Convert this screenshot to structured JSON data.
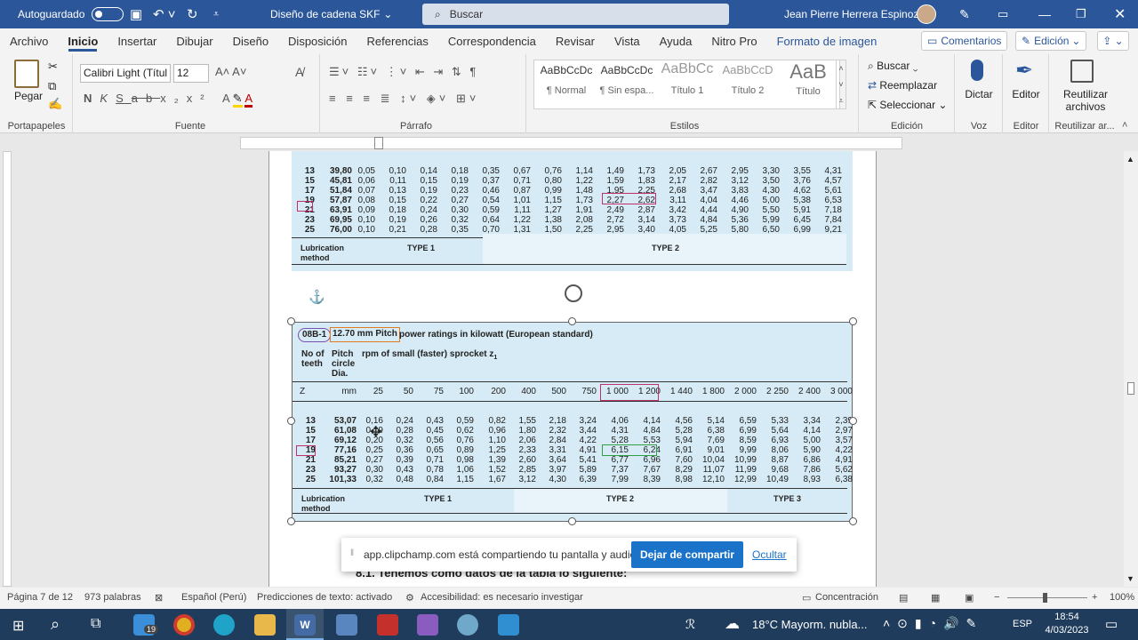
{
  "titlebar": {
    "autosave": "Autoguardado",
    "doc_title": "Diseño de cadena SKF",
    "search": "Buscar",
    "user": "Jean Pierre Herrera Espinoza"
  },
  "tabs": [
    "Archivo",
    "Inicio",
    "Insertar",
    "Dibujar",
    "Diseño",
    "Disposición",
    "Referencias",
    "Correspondencia",
    "Revisar",
    "Vista",
    "Ayuda",
    "Nitro Pro",
    "Formato de imagen"
  ],
  "tab_right": {
    "comments": "Comentarios",
    "editing": "Edición"
  },
  "ribbon": {
    "paste": "Pegar",
    "clipboard": "Portapapeles",
    "font_name": "Calibri Light (Títul",
    "font_size": "12",
    "font_group": "Fuente",
    "paragraph": "Párrafo",
    "styles": [
      {
        "preview": "AaBbCcDc",
        "name": "¶ Normal"
      },
      {
        "preview": "AaBbCcDc",
        "name": "¶ Sin espa..."
      },
      {
        "preview": "AaBbCc",
        "name": "Título 1"
      },
      {
        "preview": "AaBbCcD",
        "name": "Título 2"
      },
      {
        "preview": "AaB",
        "name": "Título"
      }
    ],
    "styles_group": "Estilos",
    "find": "Buscar",
    "replace": "Reemplazar",
    "select": "Seleccionar",
    "editing_group": "Edición",
    "dictate": "Dictar",
    "voice": "Voz",
    "editor": "Editor",
    "editor_group": "Editor",
    "reuse": "Reutilizar archivos",
    "reuse_group": "Reutilizar ar..."
  },
  "table1": {
    "rows": [
      [
        "13",
        "39,80",
        "0,05",
        "0,10",
        "0,14",
        "0,18",
        "0,35",
        "0,67",
        "0,76",
        "1,14",
        "1,49",
        "1,73",
        "2,05",
        "2,67",
        "2,95",
        "3,30",
        "3,55",
        "4,31"
      ],
      [
        "15",
        "45,81",
        "0,06",
        "0,11",
        "0,15",
        "0,19",
        "0,37",
        "0,71",
        "0,80",
        "1,22",
        "1,59",
        "1,83",
        "2,17",
        "2,82",
        "3,12",
        "3,50",
        "3,76",
        "4,57"
      ],
      [
        "17",
        "51,84",
        "0,07",
        "0,13",
        "0,19",
        "0,23",
        "0,46",
        "0,87",
        "0,99",
        "1,48",
        "1,95",
        "2,25",
        "2,68",
        "3,47",
        "3,83",
        "4,30",
        "4,62",
        "5,61"
      ],
      [
        "19",
        "57,87",
        "0,08",
        "0,15",
        "0,22",
        "0,27",
        "0,54",
        "1,01",
        "1,15",
        "1,73",
        "2,27",
        "2,62",
        "3,11",
        "4,04",
        "4,46",
        "5,00",
        "5,38",
        "6,53"
      ],
      [
        "21",
        "63,91",
        "0,09",
        "0,18",
        "0,24",
        "0,30",
        "0,59",
        "1,11",
        "1,27",
        "1,91",
        "2,49",
        "2,87",
        "3,42",
        "4,44",
        "4,90",
        "5,50",
        "5,91",
        "7,18"
      ],
      [
        "23",
        "69,95",
        "0,10",
        "0,19",
        "0,26",
        "0,32",
        "0,64",
        "1,22",
        "1,38",
        "2,08",
        "2,72",
        "3,14",
        "3,73",
        "4,84",
        "5,36",
        "5,99",
        "6,45",
        "7,84"
      ],
      [
        "25",
        "76,00",
        "0,10",
        "0,21",
        "0,28",
        "0,35",
        "0,70",
        "1,31",
        "1,50",
        "2,25",
        "2,95",
        "3,40",
        "4,05",
        "5,25",
        "5,80",
        "6,50",
        "6,99",
        "9,21"
      ]
    ],
    "lubrication": "Lubrication method",
    "type1": "TYPE 1",
    "type2": "TYPE 2"
  },
  "table2": {
    "chain": "08B-1",
    "pitch": "12.70 mm Pitch",
    "caption": "power ratings in kilowatt (European standard)",
    "col1": "No of teeth",
    "col2": "Pitch circle Dia.",
    "col3": "rpm of small (faster) sprocket z",
    "header": [
      "Z",
      "mm",
      "25",
      "50",
      "75",
      "100",
      "200",
      "400",
      "500",
      "750",
      "1 000",
      "1 200",
      "1 440",
      "1 800",
      "2 000",
      "2 250",
      "2 400",
      "3 000"
    ],
    "rows": [
      [
        "13",
        "53,07",
        "0,16",
        "0,24",
        "0,43",
        "0,59",
        "0,82",
        "1,55",
        "2,18",
        "3,24",
        "4,06",
        "4,14",
        "4,56",
        "5,14",
        "6,59",
        "5,33",
        "3,34",
        "2,39"
      ],
      [
        "15",
        "61,08",
        "0,19",
        "0,28",
        "0,45",
        "0,62",
        "0,96",
        "1,80",
        "2,32",
        "3,44",
        "4,31",
        "4,84",
        "5,28",
        "6,38",
        "6,99",
        "5,64",
        "4,14",
        "2,97"
      ],
      [
        "17",
        "69,12",
        "0,20",
        "0,32",
        "0,56",
        "0,76",
        "1,10",
        "2,06",
        "2,84",
        "4,22",
        "5,28",
        "5,53",
        "5,94",
        "7,69",
        "8,59",
        "6,93",
        "5,00",
        "3,57"
      ],
      [
        "19",
        "77,16",
        "0,25",
        "0,36",
        "0,65",
        "0,89",
        "1,25",
        "2,33",
        "3,31",
        "4,91",
        "6,15",
        "6,24",
        "6,91",
        "9,01",
        "9,99",
        "8,06",
        "5,90",
        "4,22"
      ],
      [
        "21",
        "85,21",
        "0,27",
        "0,39",
        "0,71",
        "0,98",
        "1,39",
        "2,60",
        "3,64",
        "5,41",
        "6,77",
        "6,96",
        "7,60",
        "10,04",
        "10,99",
        "8,87",
        "6,86",
        "4,91"
      ],
      [
        "23",
        "93,27",
        "0,30",
        "0,43",
        "0,78",
        "1,06",
        "1,52",
        "2,85",
        "3,97",
        "5,89",
        "7,37",
        "7,67",
        "8,29",
        "11,07",
        "11,99",
        "9,68",
        "7,86",
        "5,62"
      ],
      [
        "25",
        "101,33",
        "0,32",
        "0,48",
        "0,84",
        "1,15",
        "1,67",
        "3,12",
        "4,30",
        "6,39",
        "7,99",
        "8,39",
        "8,98",
        "12,10",
        "12,99",
        "10,49",
        "8,93",
        "6,38"
      ]
    ],
    "lubrication": "Lubrication method",
    "type1": "TYPE 1",
    "type2": "TYPE 2",
    "type3": "TYPE 3"
  },
  "body_text": "8.1. Tenemos como datos de la tabla lo siguiente:",
  "toast": {
    "message": "app.clipchamp.com está compartiendo tu pantalla y audio.",
    "stop": "Dejar de compartir",
    "hide": "Ocultar"
  },
  "status": {
    "page": "Página 7 de 12",
    "words": "973 palabras",
    "language": "Español (Perú)",
    "predictions": "Predicciones de texto: activado",
    "accessibility": "Accesibilidad: es necesario investigar",
    "focus": "Concentración",
    "zoom": "100%"
  },
  "taskbar": {
    "badge": "19",
    "weather": "18°C  Mayorm. nubla...",
    "lang": "ESP",
    "time": "18:54",
    "date": "4/03/2023"
  },
  "colors": {
    "word_blue": "#2b579a",
    "table_bg": "#d6ebf5",
    "highlight_red": "#c0306a",
    "highlight_green": "#2ea043",
    "highlight_orange": "#e07b20",
    "highlight_purple": "#7a4fb0"
  }
}
